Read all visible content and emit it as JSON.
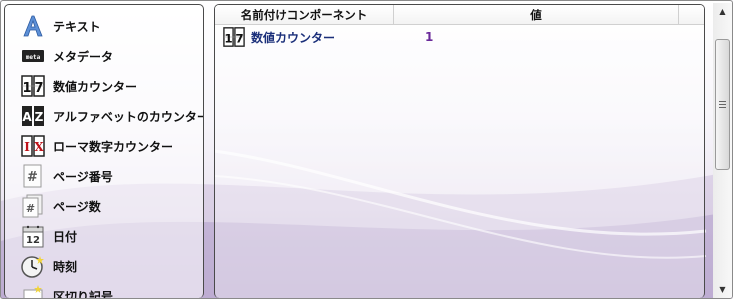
{
  "left_items": [
    {
      "label": "テキスト",
      "icon": "text-icon"
    },
    {
      "label": "メタデータ",
      "icon": "meta-icon"
    },
    {
      "label": "数値カウンター",
      "icon": "numeric-counter-icon"
    },
    {
      "label": "アルファベットのカウンター",
      "icon": "alpha-counter-icon"
    },
    {
      "label": "ローマ数字カウンター",
      "icon": "roman-counter-icon"
    },
    {
      "label": "ページ番号",
      "icon": "page-number-icon"
    },
    {
      "label": "ページ数",
      "icon": "page-count-icon"
    },
    {
      "label": "日付",
      "icon": "date-icon"
    },
    {
      "label": "時刻",
      "icon": "time-icon"
    },
    {
      "label": "区切り記号",
      "icon": "separator-icon"
    }
  ],
  "icon_text": {
    "meta": "meta",
    "numeric": "17",
    "alpha_a": "A",
    "alpha_z": "Z",
    "roman_i": "I",
    "roman_x": "X",
    "page_number": "#",
    "date": "12"
  },
  "grid": {
    "col_name": "名前付けコンポーネント",
    "col_value": "値",
    "rows": [
      {
        "name": "数値カウンター",
        "value": "1",
        "icon": "numeric-counter-icon"
      }
    ]
  },
  "colors": {
    "accent_purple": "#6a2a9a",
    "link_blue": "#1b2f7a"
  }
}
